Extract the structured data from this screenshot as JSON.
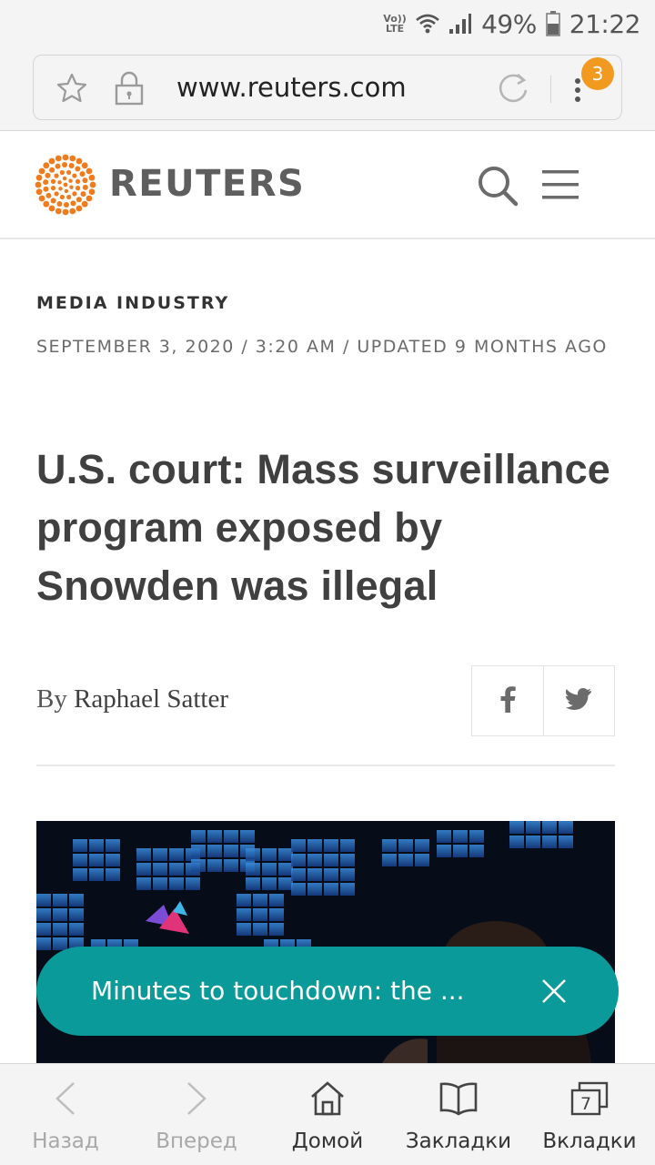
{
  "status_bar": {
    "network_label": "Vo)) LTE",
    "battery_percent": "49%",
    "time": "21:22"
  },
  "browser": {
    "url": "www.reuters.com",
    "menu_badge_count": "3"
  },
  "site": {
    "logo_text": "REUTERS",
    "brand_color": "#f07b1d"
  },
  "article": {
    "section": "MEDIA INDUSTRY",
    "dateline": "SEPTEMBER 3, 2020 / 3:20 AM / UPDATED 9 MONTHS AGO",
    "headline": "U.S. court: Mass surveillance program exposed by Snowden was illegal",
    "byline_prefix": "By",
    "author": "Raphael Satter",
    "share_buttons": [
      "facebook-icon",
      "twitter-icon"
    ]
  },
  "toast": {
    "text": "Minutes to touchdown: the ...",
    "color": "#0a9a9a"
  },
  "bottom_nav": {
    "items": [
      {
        "label": "Назад",
        "icon": "back-arrow-icon",
        "enabled": false
      },
      {
        "label": "Вперед",
        "icon": "forward-arrow-icon",
        "enabled": false
      },
      {
        "label": "Домой",
        "icon": "home-icon",
        "enabled": true
      },
      {
        "label": "Закладки",
        "icon": "bookmarks-icon",
        "enabled": true
      },
      {
        "label": "Вкладки",
        "icon": "tabs-icon",
        "enabled": true,
        "count": "7"
      }
    ]
  }
}
